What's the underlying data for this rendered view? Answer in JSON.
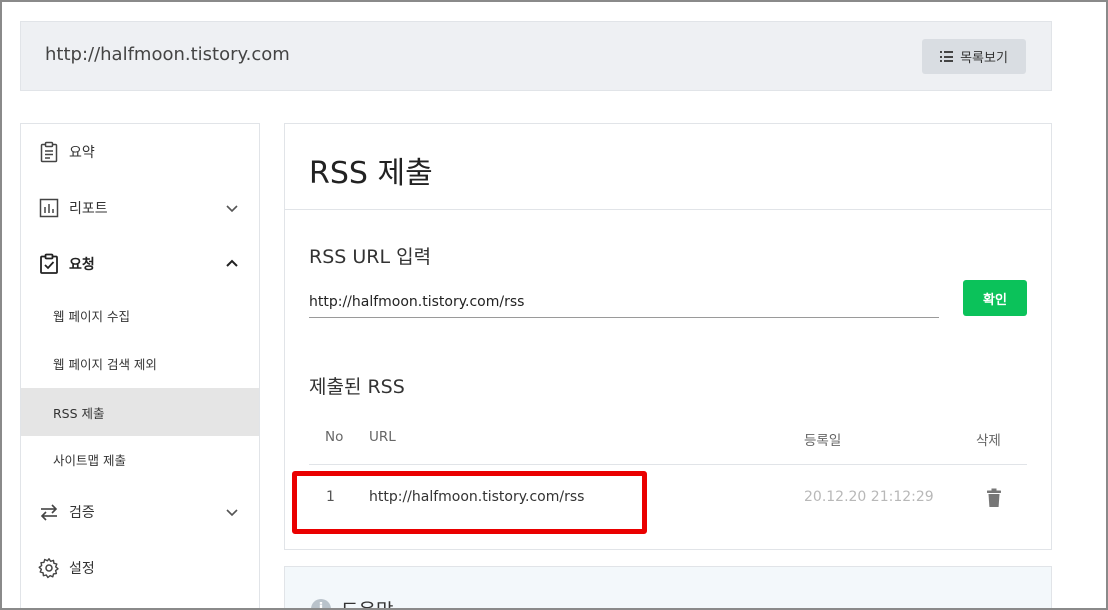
{
  "header": {
    "site_url": "http://halfmoon.tistory.com",
    "list_button_label": "목록보기",
    "list_icon": "list-icon"
  },
  "sidebar": {
    "items": [
      {
        "label": "요약",
        "icon": "clipboard-icon"
      },
      {
        "label": "리포트",
        "icon": "bar-chart-icon",
        "expanded": false
      },
      {
        "label": "요청",
        "icon": "clipboard-check-icon",
        "expanded": true
      },
      {
        "label": "검증",
        "icon": "swap-arrows-icon",
        "expanded": false
      },
      {
        "label": "설정",
        "icon": "gear-icon"
      }
    ],
    "sub_items": [
      {
        "label": "웹 페이지 수집"
      },
      {
        "label": "웹 페이지 검색 제외"
      },
      {
        "label": "RSS 제출",
        "active": true
      },
      {
        "label": "사이트맵 제출"
      }
    ]
  },
  "main": {
    "title": "RSS 제출",
    "input_label": "RSS URL 입력",
    "input_value": "http://halfmoon.tistory.com/rss",
    "confirm_label": "확인",
    "accent_color": "#0bc25a",
    "submitted_title": "제출된 RSS",
    "table": {
      "headers": {
        "no": "No",
        "url": "URL",
        "date": "등록일",
        "delete": "삭제"
      },
      "rows": [
        {
          "no": "1",
          "url": "http://halfmoon.tistory.com/rss",
          "date": "20.12.20 21:12:29"
        }
      ]
    }
  },
  "help": {
    "title": "도움말"
  },
  "highlight_color": "#ea0000"
}
